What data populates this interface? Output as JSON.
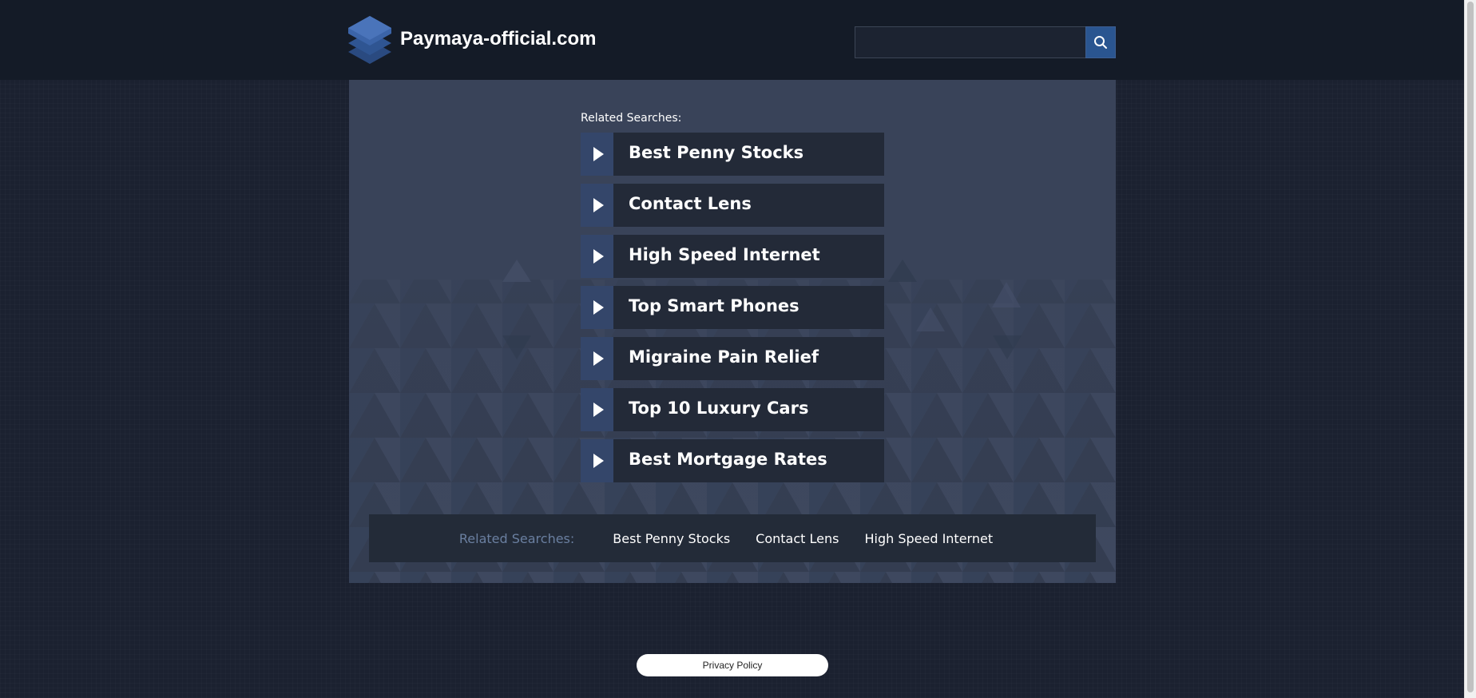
{
  "header": {
    "site_title": "Paymaya-official.com",
    "search": {
      "value": "",
      "placeholder": ""
    }
  },
  "main": {
    "related_label": "Related Searches:",
    "results": [
      {
        "label": "Best Penny Stocks"
      },
      {
        "label": "Contact Lens"
      },
      {
        "label": "High Speed Internet"
      },
      {
        "label": "Top Smart Phones"
      },
      {
        "label": "Migraine Pain Relief"
      },
      {
        "label": "Top 10 Luxury Cars"
      },
      {
        "label": "Best Mortgage Rates"
      }
    ]
  },
  "bottom_bar": {
    "label": "Related Searches:",
    "links": [
      "Best Penny Stocks",
      "Contact Lens",
      "High Speed Internet"
    ]
  },
  "footer": {
    "privacy_label": "Privacy Policy"
  },
  "colors": {
    "page_bg": "#1b2130",
    "header_bg": "#141b27",
    "panel_bg": "#394359",
    "item_bg": "#232a38",
    "arrow_bg": "#34466a",
    "accent": "#2a5590",
    "bottom_label": "#6a7fa0"
  },
  "icons": {
    "logo": "stacked-layers-icon",
    "search": "search-icon",
    "arrow": "play-arrow-icon"
  }
}
